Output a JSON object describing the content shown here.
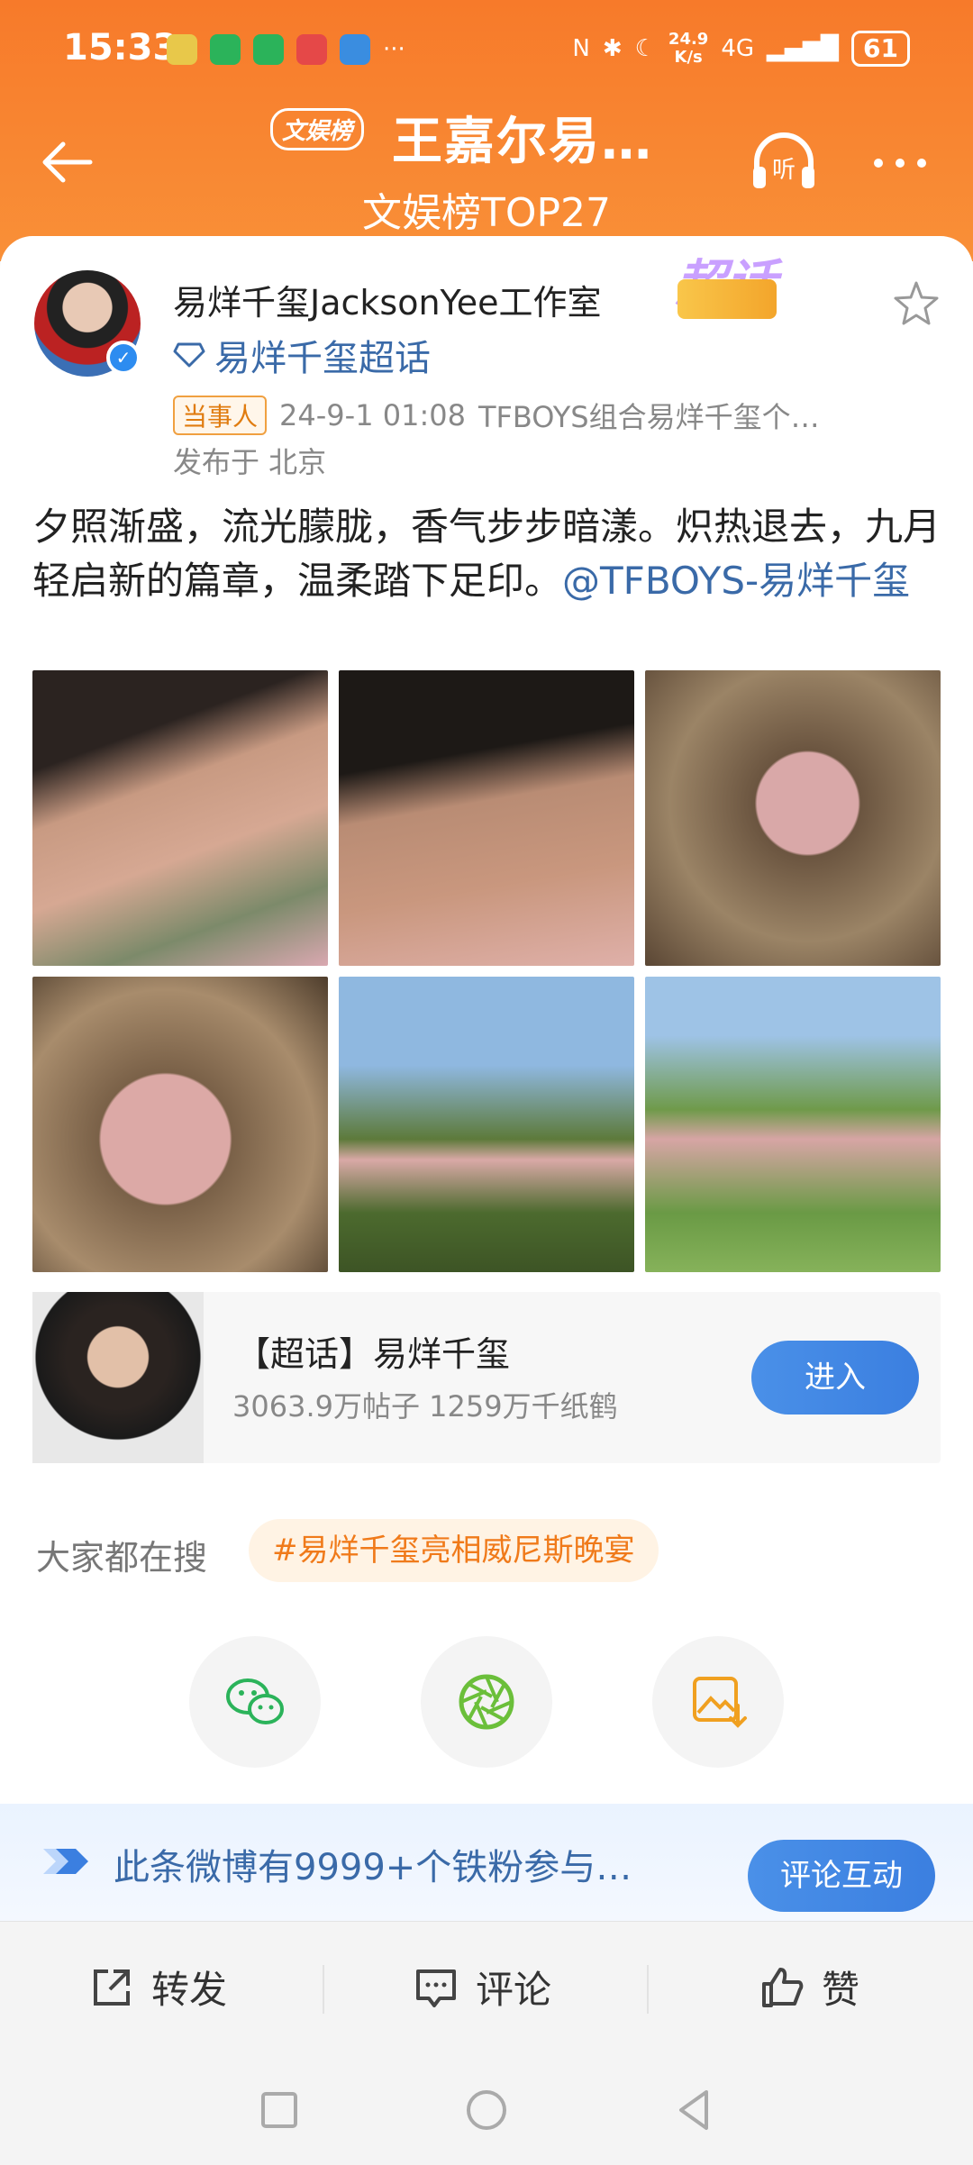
{
  "status_bar": {
    "time": "15:33",
    "network_speed": "24.9\nK/s",
    "network_type": "4G",
    "battery": "61"
  },
  "header": {
    "tag": "文娱榜",
    "title": "王嘉尔易…",
    "subtitle": "文娱榜TOP27",
    "listen_label": "听"
  },
  "post": {
    "author": "易烊千玺JacksonYee工作室",
    "super_topic_link": "易烊千玺超话",
    "role_tag": "当事人",
    "timestamp": "24-9-1 01:08",
    "source": "TFBOYS组合易烊千玺个…",
    "location": "发布于 北京",
    "text": "夕照渐盛，流光朦胧，香气步步暗漾。炽热退去，九月轻启新的篇章，温柔踏下足印。",
    "mention": "@TFBOYS-易烊千玺",
    "badge": "超话"
  },
  "topic_card": {
    "title": "【超话】易烊千玺",
    "stats": "3063.9万帖子 1259万千纸鹤",
    "button": "进入"
  },
  "search": {
    "label": "大家都在搜",
    "tag": "#易烊千玺亮相威尼斯晚宴"
  },
  "fan_bar": {
    "text": "此条微博有9999+个铁粉参与…",
    "button": "评论互动"
  },
  "actions": {
    "repost": "转发",
    "comment": "评论",
    "like": "赞"
  },
  "colors": {
    "header_orange": "#f77a2a",
    "link_blue": "#3a6aa8",
    "button_blue": "#3b7fe0",
    "tag_orange": "#f07a1a"
  }
}
